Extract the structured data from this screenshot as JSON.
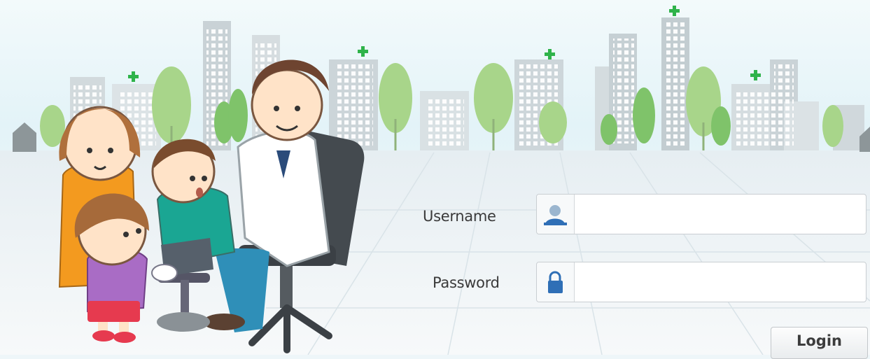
{
  "login_form": {
    "username_label": "Username",
    "password_label": "Password",
    "username_value": "",
    "password_value": "",
    "login_label": "Login",
    "username_icon": "user-icon",
    "password_icon": "lock-icon"
  },
  "colors": {
    "sky": "#dff1f6",
    "tree_green": "#9fd27a",
    "plus_green": "#2fb34a",
    "field_border": "#c9ced2",
    "icon_blue": "#2f6fb6"
  }
}
